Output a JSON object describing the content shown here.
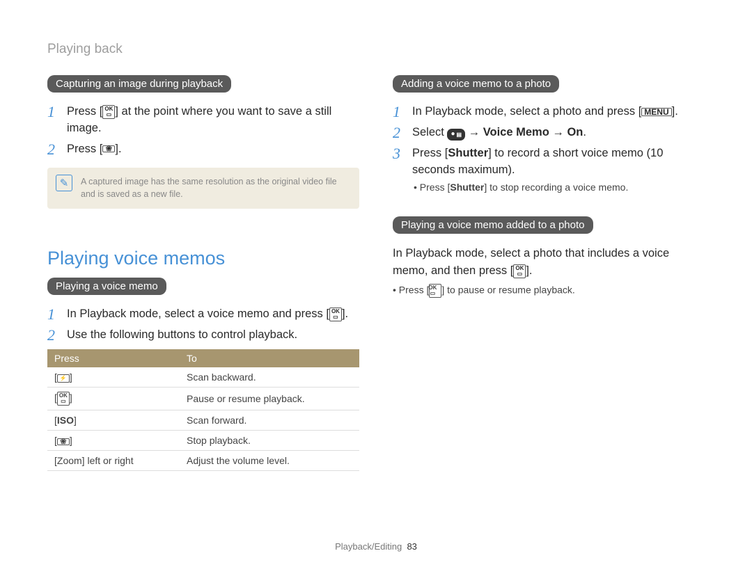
{
  "breadcrumb": "Playing back",
  "left": {
    "pill1": "Capturing an image during playback",
    "step1_pre": "Press [",
    "step1_post": "] at the point where you want to save a still image.",
    "step2_pre": "Press [",
    "step2_post": "].",
    "note": "A captured image has the same resolution as the original video file and is saved as a new file.",
    "h2": "Playing voice memos",
    "pill2": "Playing a voice memo",
    "pvm_step1_pre": "In Playback mode, select a voice memo and press [",
    "pvm_step1_post": "].",
    "pvm_step2": "Use the following buttons to control playback.",
    "table": {
      "h1": "Press",
      "h2": "To",
      "rows": [
        {
          "k_pre": "[",
          "k_icon": "flash",
          "k_post": "]",
          "v": "Scan backward."
        },
        {
          "k_pre": "[",
          "k_icon": "ok",
          "k_post": "]",
          "v": "Pause or resume playback."
        },
        {
          "k_pre": "[",
          "k_icon": "iso",
          "k_post": "]",
          "v": "Scan forward."
        },
        {
          "k_pre": "[",
          "k_icon": "tulip",
          "k_post": "]",
          "v": "Stop playback."
        },
        {
          "k_full": "[Zoom] left or right",
          "v": "Adjust the volume level."
        }
      ]
    }
  },
  "right": {
    "pill1": "Adding a voice memo to a photo",
    "s1_pre": "In Playback mode, select a photo and press [",
    "s1_post": "].",
    "s2_pre": "Select ",
    "s2_arrow1": " → ",
    "s2_vm": "Voice Memo",
    "s2_arrow2": " → ",
    "s2_on": "On",
    "s2_post": ".",
    "s3_pre": "Press [",
    "s3_shutter": "Shutter",
    "s3_post": "] to record a short voice memo (10 seconds maximum).",
    "s3_sub_pre": "• Press [",
    "s3_sub_shutter": "Shutter",
    "s3_sub_post": "] to stop recording a voice memo.",
    "pill2": "Playing a voice memo added to a photo",
    "para_pre": "In Playback mode, select a photo that includes a voice memo, and then press [",
    "para_post": "].",
    "sub_pre": "• Press [",
    "sub_post": "] to pause or resume playback."
  },
  "footer": {
    "section": "Playback/Editing",
    "page": "83"
  }
}
